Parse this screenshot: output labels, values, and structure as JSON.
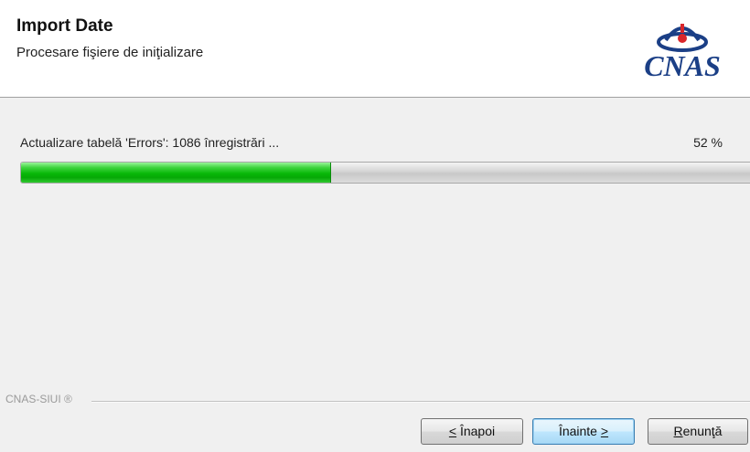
{
  "header": {
    "title": "Import Date",
    "subtitle": "Procesare fişiere de iniţializare",
    "logo_text": "CNAS"
  },
  "progress": {
    "status_text": "Actualizare tabelă 'Errors': 1086 înregistrări ...",
    "percent_text": "52 %",
    "value": 0.42
  },
  "footer": {
    "brand": "CNAS-SIUI ®"
  },
  "buttons": {
    "back": {
      "mnemonic": "<",
      "rest": " Înapoi"
    },
    "next": {
      "label": "Înainte",
      "mnemonic": ">"
    },
    "cancel": {
      "mnemonic": "R",
      "rest": "enunţă"
    }
  },
  "colors": {
    "progress_fill": "#08b808",
    "logo_blue": "#1b3f86",
    "logo_red": "#d9262b"
  },
  "icons": {
    "logo_mark": "cnas-emblem-icon"
  }
}
